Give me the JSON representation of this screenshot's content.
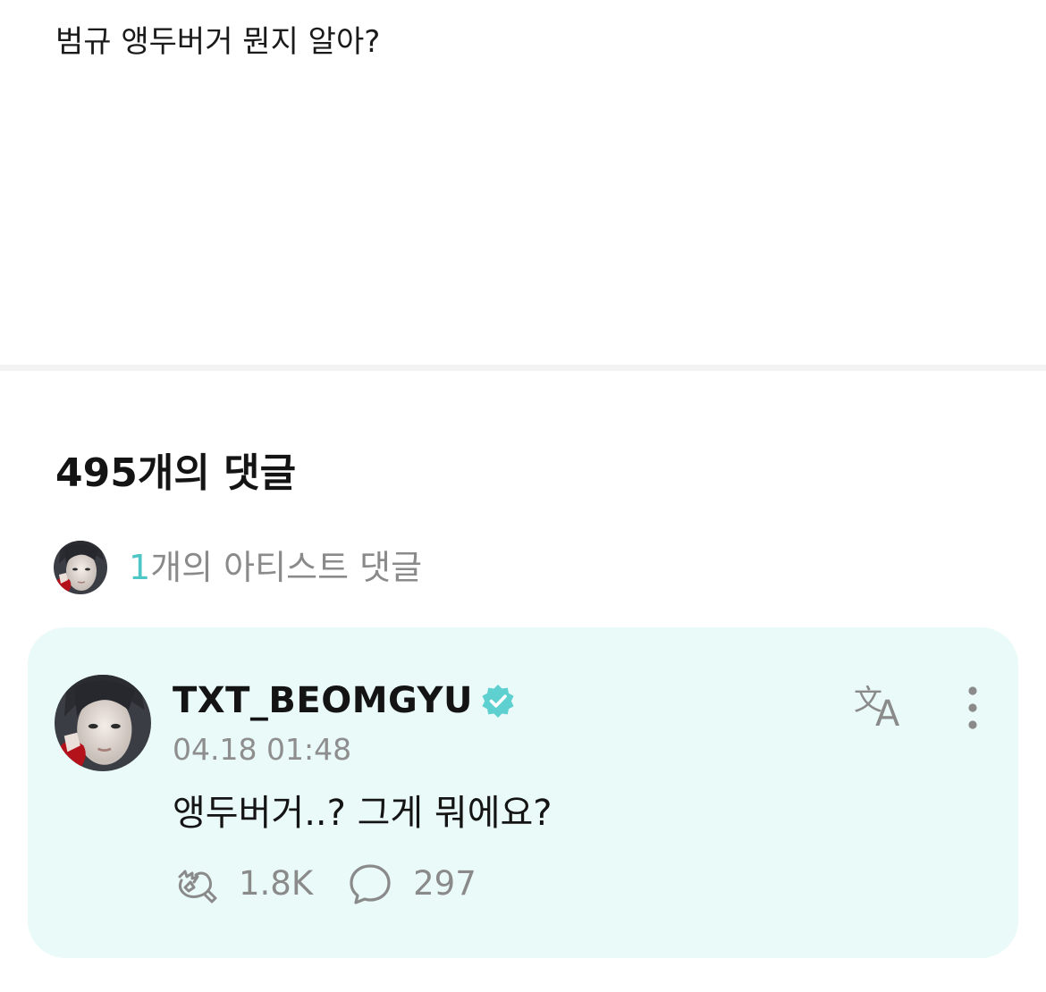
{
  "post": {
    "text": "범규 앵두버거 뭔지 알아?"
  },
  "comments_section": {
    "count_label": "495개의 댓글",
    "artist_summary": {
      "count": "1",
      "label": "개의 아티스트 댓글"
    }
  },
  "artist_comment": {
    "author": "TXT_BEOMGYU",
    "timestamp": "04.18 01:48",
    "text": "앵두버거..? 그게 뭐에요?",
    "reactions": {
      "like_count": "1.8K",
      "reply_count": "297"
    },
    "icons": {
      "verified": "verified-check-icon",
      "translate": "translate-icon",
      "more": "more-vertical-icon",
      "like": "cheer-like-icon",
      "reply": "speech-bubble-icon"
    }
  },
  "colors": {
    "accent": "#4fc6c6",
    "card_background": "#e9faf8",
    "muted_text": "#8a8a8a",
    "divider": "#f3f3f3"
  }
}
